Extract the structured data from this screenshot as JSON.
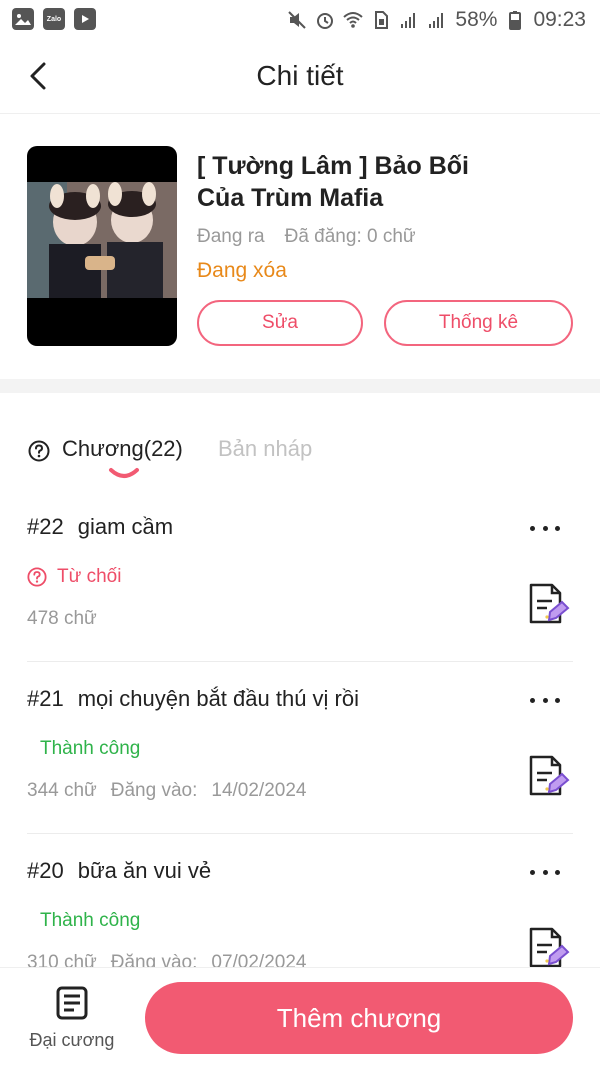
{
  "status_bar": {
    "battery": "58%",
    "time": "09:23",
    "apps": [
      "gallery-icon",
      "zalo-icon",
      "tv-icon"
    ],
    "zalo_label": "Zalo"
  },
  "header": {
    "title": "Chi tiết"
  },
  "book": {
    "title": "[ Tường Lâm ] Bảo Bối Của Trùm Mafia",
    "state": "Đang ra",
    "posted": "Đã đăng: 0 chữ",
    "status": "Đang xóa",
    "edit_label": "Sửa",
    "stats_label": "Thống kê"
  },
  "tabs": {
    "chapters_label": "Chương(22)",
    "drafts_label": "Bản nháp"
  },
  "chapters": [
    {
      "number": "#22",
      "title": "giam cầm",
      "status": "Từ chối",
      "status_type": "rejected",
      "words": "478 chữ",
      "posted_label": "",
      "posted_date": ""
    },
    {
      "number": "#21",
      "title": "mọi chuyện bắt đầu thú vị rồi",
      "status": "Thành công",
      "status_type": "success",
      "words": "344 chữ",
      "posted_label": "Đăng vào:",
      "posted_date": "14/02/2024"
    },
    {
      "number": "#20",
      "title": "bữa ăn vui vẻ",
      "status": "Thành công",
      "status_type": "success",
      "words": "310 chữ",
      "posted_label": "Đăng vào:",
      "posted_date": "07/02/2024"
    }
  ],
  "bottom": {
    "outline_label": "Đại cương",
    "add_chapter_label": "Thêm chương"
  },
  "colors": {
    "accent": "#f25a72",
    "warning": "#e8891a",
    "success": "#2fb34a",
    "rejected": "#ee4d68"
  }
}
